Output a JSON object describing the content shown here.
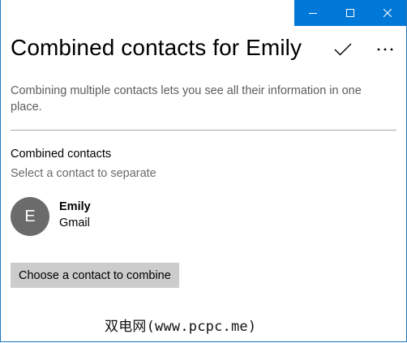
{
  "window": {
    "accent_color": "#0078d7",
    "controls": [
      {
        "name": "minimize",
        "icon": "minimize-icon"
      },
      {
        "name": "maximize",
        "icon": "maximize-icon"
      },
      {
        "name": "close",
        "icon": "close-icon"
      }
    ]
  },
  "header": {
    "title": "Combined contacts for Emily",
    "actions": [
      {
        "name": "save",
        "icon": "checkmark-icon"
      },
      {
        "name": "more",
        "icon": "more-icon"
      }
    ]
  },
  "main": {
    "description": "Combining multiple contacts lets you see all their information in one place.",
    "section_title": "Combined contacts",
    "section_hint": "Select a contact to separate",
    "contacts": [
      {
        "initial": "E",
        "name": "Emily",
        "source": "Gmail",
        "avatar_color": "#6b6b6b"
      }
    ],
    "combine_button_label": "Choose a contact to combine"
  },
  "watermark": "双电网(www.pcpc.me)"
}
